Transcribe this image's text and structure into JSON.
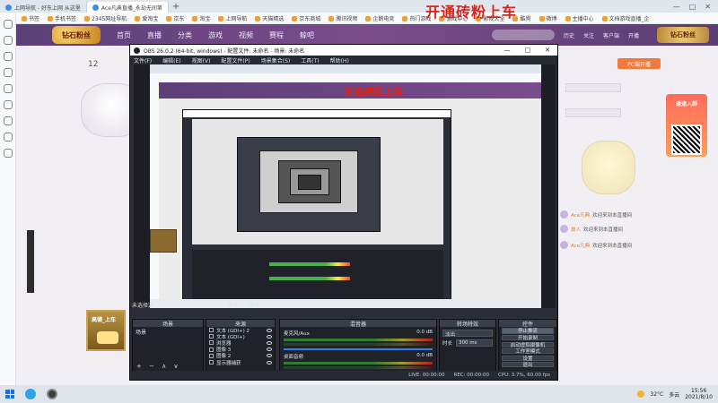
{
  "browser": {
    "tabs": [
      {
        "label": "上网导航 - 好东上网 从这里"
      },
      {
        "label": "Ace凡典直播_永劫无间第"
      }
    ],
    "new_tab": "+",
    "bookmarks": [
      "书签",
      "手机书签",
      "2345网址导航",
      "爱淘宝",
      "京东",
      "淘宝",
      "上网导航",
      "天猫精选",
      "京东商城",
      "腾讯视频",
      "企鹅电竞",
      "热门游戏",
      "游戏中心",
      "影视大全",
      "酷狗",
      "微博",
      "主播中心",
      "文档游戏直播_企"
    ],
    "window_controls": [
      "—",
      "□",
      "✕"
    ]
  },
  "site": {
    "logo_text": "钻石粉丝",
    "nav_items": [
      "首页",
      "直播",
      "分类",
      "游戏",
      "视频",
      "赛程",
      "鲸吧"
    ],
    "nav_icons": [
      "历史",
      "关注",
      "客户端",
      "开播"
    ],
    "pc_badge": "钻石粉丝",
    "room_count": "12",
    "host_name": "有车",
    "pc_live_label": "PC端开播",
    "promo_text": "速速入群",
    "gift_lines": [
      {
        "user": "Ace凡典",
        "text": "欢迎来到本直播间"
      },
      {
        "user": "旅人",
        "text": "欢迎来到本直播间"
      },
      {
        "user": "Ace凡典",
        "text": "欢迎来到本直播间"
      }
    ]
  },
  "overlay_text": "开通砖粉上车",
  "obs": {
    "title": "OBS 26.0.2 (64-bit, windows) - 配置文件: 未命名 - 场景: 未命名",
    "window_controls": [
      "—",
      "□",
      "✕"
    ],
    "menu": [
      "文件(F)",
      "编辑(E)",
      "视图(V)",
      "配置文件(P)",
      "场景集合(S)",
      "工具(T)",
      "帮助(H)"
    ],
    "preview_text": "开通砖粉上车",
    "dock_tab_label": "未选择源",
    "dock_tab_properties": "属性",
    "dock_tab_filters": "滤镜",
    "scenes_title": "场景",
    "scenes": [
      "场景"
    ],
    "sources_title": "来源",
    "sources": [
      "文本 (GDI+) 2",
      "文本 (GDI+)",
      "浏览器",
      "图像 3",
      "图像 2",
      "显示器捕获"
    ],
    "mixer_title": "混音器",
    "mixer_tracks": [
      {
        "name": "麦克风/Aux",
        "db": "0.0 dB"
      },
      {
        "name": "桌面音频",
        "db": "0.0 dB"
      }
    ],
    "transitions_title": "转场特效",
    "transition_type": "淡出",
    "duration_label": "时长",
    "duration_value": "300 ms",
    "controls_title": "控件",
    "controls": [
      "停止推流",
      "开始录制",
      "启动虚拟摄像机",
      "工作室模式",
      "设置",
      "退出"
    ],
    "dock_footer": "+ − ∧ ∨",
    "status": [
      "LIVE: 00:00:00",
      "REC: 00:00:00",
      "CPU: 3.7%, 60.00 fps"
    ]
  },
  "left_thumb_text": "高德_上车",
  "taskbar": {
    "temperature": "32°C",
    "weather": "多云",
    "time": "15:56",
    "date": "2021/8/10"
  }
}
